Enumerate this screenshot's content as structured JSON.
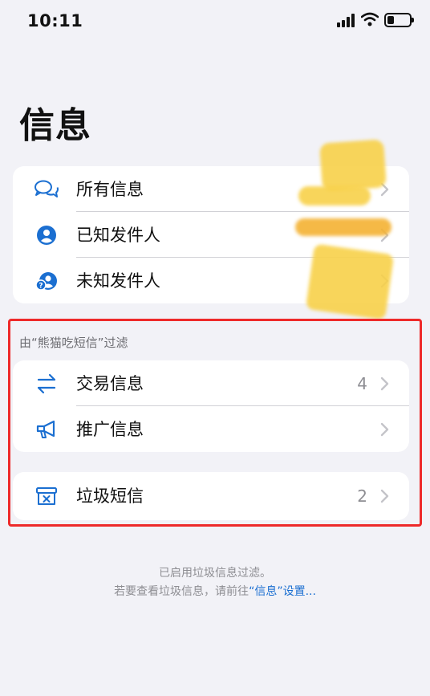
{
  "status_bar": {
    "time": "10:11"
  },
  "title": "信息",
  "senders": [
    {
      "label": "所有信息",
      "icon": "chat-bubbles-icon"
    },
    {
      "label": "已知发件人",
      "icon": "person-circle-icon"
    },
    {
      "label": "未知发件人",
      "icon": "person-question-icon"
    }
  ],
  "filter_header": "由“熊猫吃短信”过滤",
  "filter_items": [
    {
      "label": "交易信息",
      "count": "4",
      "icon": "arrows-swap-icon"
    },
    {
      "label": "推广信息",
      "count": "",
      "icon": "megaphone-icon"
    }
  ],
  "junk": {
    "label": "垃圾短信",
    "count": "2",
    "icon": "junk-box-icon"
  },
  "footer": {
    "line1": "已启用垃圾信息过滤。",
    "line2_prefix": "若要查看垃圾信息，请前往",
    "line2_link": "“信息”设置..."
  },
  "colors": {
    "accent": "#1b6fd1",
    "highlight": "#ee2a2a",
    "background": "#f2f2f7"
  }
}
